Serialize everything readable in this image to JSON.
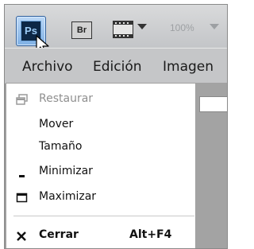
{
  "toolbar": {
    "ps_label": "Ps",
    "br_label": "Br",
    "zoom": "100%"
  },
  "menubar": {
    "items": [
      "Archivo",
      "Edición",
      "Imagen"
    ]
  },
  "system_menu": {
    "items": [
      {
        "label": "Restaurar",
        "icon": "restore-icon",
        "enabled": false
      },
      {
        "label": "Mover",
        "enabled": true
      },
      {
        "label": "Tamaño",
        "enabled": true
      },
      {
        "label": "Minimizar",
        "icon": "minimize-icon",
        "enabled": true
      },
      {
        "label": "Maximizar",
        "icon": "maximize-icon",
        "enabled": true
      },
      {
        "label": "Cerrar",
        "icon": "close-icon",
        "shortcut": "Alt+F4",
        "enabled": true,
        "bold": true
      }
    ]
  },
  "colors": {
    "titlebar": "#c3c5c8",
    "menubar": "#c5c6c8",
    "ps_button": "#7fb0e4",
    "disabled_text": "#8f8f8f"
  }
}
